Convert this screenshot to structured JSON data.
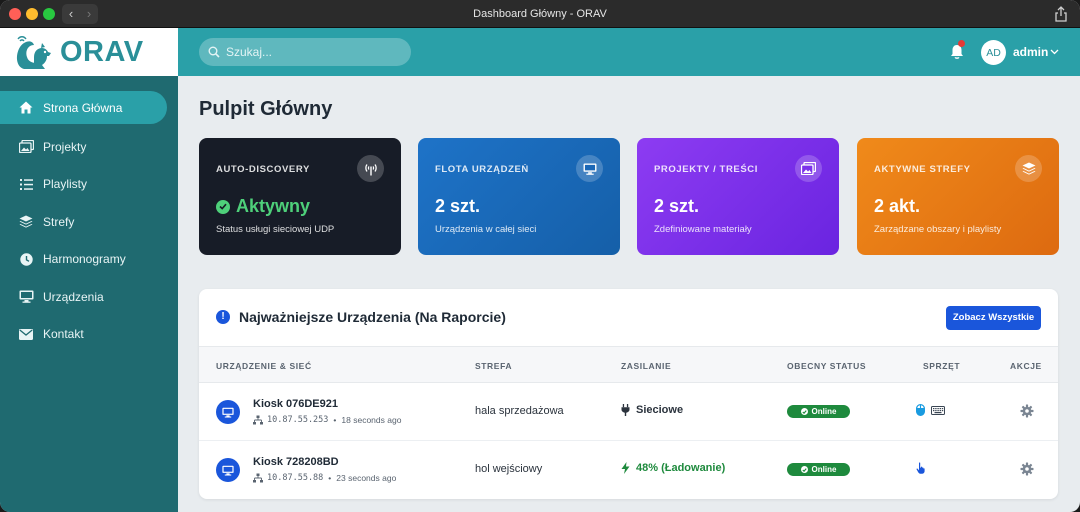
{
  "window": {
    "title": "Dashboard Główny - ORAV",
    "back_glyph": "‹",
    "forward_glyph": "›"
  },
  "sidebar": {
    "logo_text": "ORAV",
    "logo_icon": "squirrel-icon",
    "items": [
      {
        "label": "Strona Główna",
        "icon": "home-icon",
        "active": true
      },
      {
        "label": "Projekty",
        "icon": "images-icon"
      },
      {
        "label": "Playlisty",
        "icon": "list-icon"
      },
      {
        "label": "Strefy",
        "icon": "layers-icon"
      },
      {
        "label": "Harmonogramy",
        "icon": "clock-icon"
      },
      {
        "label": "Urządzenia",
        "icon": "monitor-icon"
      },
      {
        "label": "Kontakt",
        "icon": "envelope-icon"
      }
    ]
  },
  "topbar": {
    "search_placeholder": "Szukaj...",
    "avatar_initials": "AD",
    "username": "admin",
    "has_notification": true
  },
  "page": {
    "title": "Pulpit Główny"
  },
  "cards": [
    {
      "title": "AUTO-DISCOVERY",
      "value": "Aktywny",
      "subtitle": "Status usługi sieciowej UDP",
      "icon": "broadcast-tower-icon"
    },
    {
      "title": "FLOTA URZĄDZEŃ",
      "value": "2 szt.",
      "subtitle": "Urządzenia w całej sieci",
      "icon": "monitor-icon"
    },
    {
      "title": "PROJEKTY / TREŚCI",
      "value": "2 szt.",
      "subtitle": "Zdefiniowane materiały",
      "icon": "images-icon"
    },
    {
      "title": "AKTYWNE STREFY",
      "value": "2 akt.",
      "subtitle": "Zarządzane obszary i playlisty",
      "icon": "layers-icon"
    }
  ],
  "panel": {
    "title": "Najważniejsze Urządzenia (Na Raporcie)",
    "button_label": "Zobacz Wszystkie",
    "columns": [
      "URZĄDZENIE & SIEĆ",
      "STREFA",
      "ZASILANIE",
      "OBECNY STATUS",
      "SPRZĘT",
      "AKCJE"
    ],
    "rows": [
      {
        "name": "Kiosk 076DE921",
        "ip": "10.87.55.253",
        "separator": "•",
        "last_seen": "18 seconds ago",
        "zone": "hala sprzedażowa",
        "power": "Sieciowe",
        "power_icon": "plug-icon",
        "status": "Online",
        "hardware": [
          "mouse-icon",
          "keyboard-icon"
        ]
      },
      {
        "name": "Kiosk 728208BD",
        "ip": "10.87.55.88",
        "separator": "•",
        "last_seen": "23 seconds ago",
        "zone": "hol wejściowy",
        "power": "48% (Ładowanie)",
        "power_icon": "bolt-icon",
        "status": "Online",
        "hardware": [
          "touch-hand-icon"
        ]
      }
    ]
  },
  "colors": {
    "sidebar": "#1f6a70",
    "accent": "#2aa0a8",
    "primary_button": "#1a56db",
    "online": "#1e8a3d",
    "notification": "#e53935"
  }
}
